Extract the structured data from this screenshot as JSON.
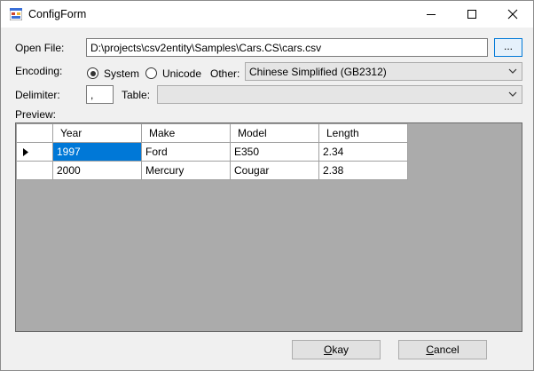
{
  "window": {
    "title": "ConfigForm"
  },
  "open_file": {
    "label": "Open File:",
    "value": "D:\\projects\\csv2entity\\Samples\\Cars.CS\\cars.csv",
    "browse_label": "..."
  },
  "encoding": {
    "label": "Encoding:",
    "system_label": "System",
    "unicode_label": "Unicode",
    "selected": "System",
    "other_label": "Other:",
    "other_value": "Chinese Simplified (GB2312)"
  },
  "delimiter": {
    "label": "Delimiter:",
    "value": ","
  },
  "table": {
    "label": "Table:",
    "value": ""
  },
  "preview": {
    "label": "Preview:",
    "columns": [
      "Year",
      "Make",
      "Model",
      "Length"
    ],
    "rows": [
      [
        "1997",
        "Ford",
        "E350",
        "2.34"
      ],
      [
        "2000",
        "Mercury",
        "Cougar",
        "2.38"
      ]
    ],
    "current_row": 0,
    "selected_cell": "1997"
  },
  "buttons": {
    "okay_hotkey": "O",
    "okay_rest": "kay",
    "cancel_hotkey": "C",
    "cancel_rest": "ancel"
  }
}
